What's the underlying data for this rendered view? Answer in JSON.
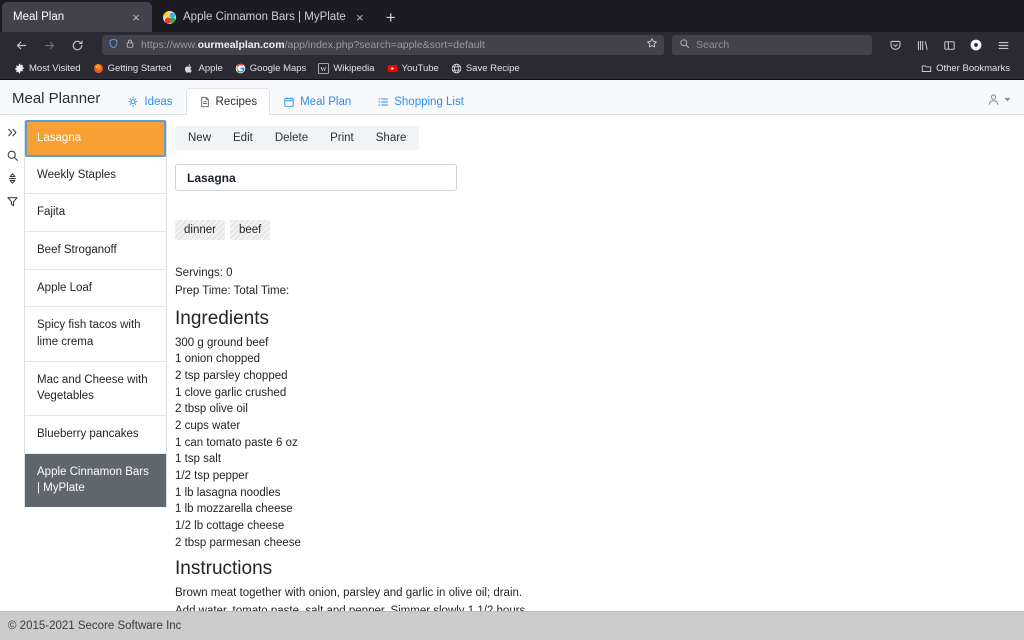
{
  "browser": {
    "tabs": [
      {
        "title": "Meal Plan",
        "active": true,
        "has_favicon": false,
        "close_glyph": "×"
      },
      {
        "title": "Apple Cinnamon Bars | MyPlate",
        "active": false,
        "has_favicon": true,
        "close_glyph": "×"
      }
    ],
    "new_tab_label": "+",
    "url": {
      "prefix": "https://www.",
      "domain": "ourmealplan.com",
      "suffix": "/app/index.php?search=apple&sort=default"
    },
    "search_placeholder": "Search",
    "bookmarks": [
      {
        "label": "Most Visited",
        "icon": "gear-icon"
      },
      {
        "label": "Getting Started",
        "icon": "firefox-icon"
      },
      {
        "label": "Apple",
        "icon": "apple-icon"
      },
      {
        "label": "Google Maps",
        "icon": "google-icon"
      },
      {
        "label": "Wikipedia",
        "icon": "wikipedia-icon"
      },
      {
        "label": "YouTube",
        "icon": "youtube-icon"
      },
      {
        "label": "Save Recipe",
        "icon": "globe-icon"
      }
    ],
    "other_bookmarks": "Other Bookmarks"
  },
  "app": {
    "brand": "Meal Planner",
    "nav_tabs": [
      {
        "label": "Ideas",
        "icon": "idea-icon",
        "active": false
      },
      {
        "label": "Recipes",
        "icon": "document-icon",
        "active": true
      },
      {
        "label": "Meal Plan",
        "icon": "calendar-icon",
        "active": false
      },
      {
        "label": "Shopping List",
        "icon": "list-icon",
        "active": false
      }
    ]
  },
  "rail": {
    "icons": [
      "expand-chevrons-icon",
      "search-icon",
      "sort-icon",
      "filter-icon"
    ]
  },
  "recipe_list": [
    {
      "name": "Lasagna",
      "state": "selected"
    },
    {
      "name": "Weekly Staples",
      "state": "normal"
    },
    {
      "name": "Fajita",
      "state": "normal"
    },
    {
      "name": "Beef Stroganoff",
      "state": "normal"
    },
    {
      "name": "Apple Loaf",
      "state": "normal"
    },
    {
      "name": "Spicy fish tacos with lime crema",
      "state": "normal"
    },
    {
      "name": "Mac and Cheese with Vegetables",
      "state": "normal"
    },
    {
      "name": "Blueberry pancakes",
      "state": "normal"
    },
    {
      "name": "Apple Cinnamon Bars | MyPlate",
      "state": "dark"
    }
  ],
  "toolbar": {
    "commands": [
      "New",
      "Edit",
      "Delete",
      "Print",
      "Share"
    ]
  },
  "recipe": {
    "title": "Lasagna",
    "tags": [
      "dinner",
      "beef"
    ],
    "servings_line": "Servings: 0",
    "time_line": "Prep Time: Total Time:",
    "ingredients_heading": "Ingredients",
    "ingredients": [
      "300 g ground beef",
      "1 onion chopped",
      "2 tsp parsley chopped",
      "1 clove garlic crushed",
      "2 tbsp olive oil",
      "2 cups water",
      "1 can tomato paste 6 oz",
      "1 tsp salt",
      "1/2 tsp pepper",
      "1 lb lasagna noodles",
      "1 lb mozzarella cheese",
      "1/2 lb cottage cheese",
      "2 tbsp parmesan cheese"
    ],
    "instructions_heading": "Instructions",
    "instructions": [
      "Brown meat together with onion, parsley and garlic in olive oil; drain.",
      "Add water, tomato paste, salt and pepper. Simmer slowly 1 1/2 hours."
    ]
  },
  "footer": {
    "copyright": "© 2015-2021 Secore Software Inc"
  },
  "colors": {
    "chrome_bg": "#1c1b22",
    "toolbar_bg": "#2b2a33",
    "accent_link": "#2d8cf0",
    "selected_recipe": "#f7a033",
    "dark_recipe": "#5d676d",
    "footer_bg": "#cccccc"
  }
}
